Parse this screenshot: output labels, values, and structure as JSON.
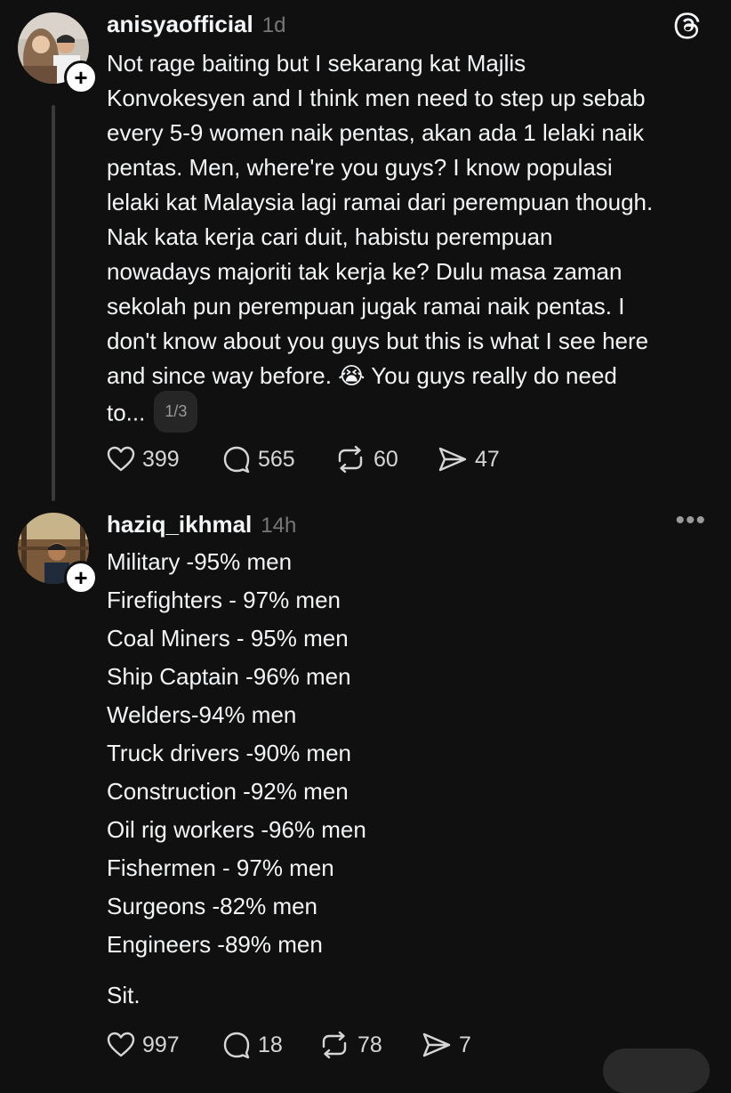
{
  "post1": {
    "username": "anisyaofficial",
    "time": "1d",
    "text": "Not rage baiting but I sekarang kat Majlis\nKonvokesyen and I think men need to step up sebab\nevery 5-9 women naik pentas, akan ada 1 lelaki naik\npentas. Men, where're you guys? I know populasi\nlelaki kat Malaysia lagi ramai dari perempuan though.\nNak kata kerja cari duit, habistu perempuan\nnowadays majoriti tak kerja ke? Dulu masa zaman\nsekolah pun perempuan jugak ramai naik pentas. I\ndon't know about you guys but this is what I see here\nand since way before. 😭 You guys really do need\nto...",
    "page_indicator": "1/3",
    "likes": "399",
    "replies": "565",
    "reposts": "60",
    "shares": "47"
  },
  "post2": {
    "username": "haziq_ikhmal",
    "time": "14h",
    "lines": [
      "Military -95% men",
      "Firefighters - 97% men",
      "Coal Miners - 95% men",
      "Ship Captain -96% men",
      "Welders-94% men",
      "Truck drivers -90% men",
      "Construction -92% men",
      "Oil rig workers -96% men",
      "Fishermen - 97% men",
      "Surgeons -82% men",
      "Engineers -89% men"
    ],
    "closing": "Sit.",
    "likes": "997",
    "replies": "18",
    "reposts": "78",
    "shares": "7"
  },
  "icons": {
    "brand": "threads-logo-icon",
    "like": "heart-icon",
    "reply": "speech-bubble-icon",
    "repost": "repost-icon",
    "share": "send-icon",
    "more": "more-dots-icon",
    "follow": "plus-icon"
  },
  "colors": {
    "background": "#101010",
    "text": "#f3f5f7",
    "muted": "#777777"
  }
}
